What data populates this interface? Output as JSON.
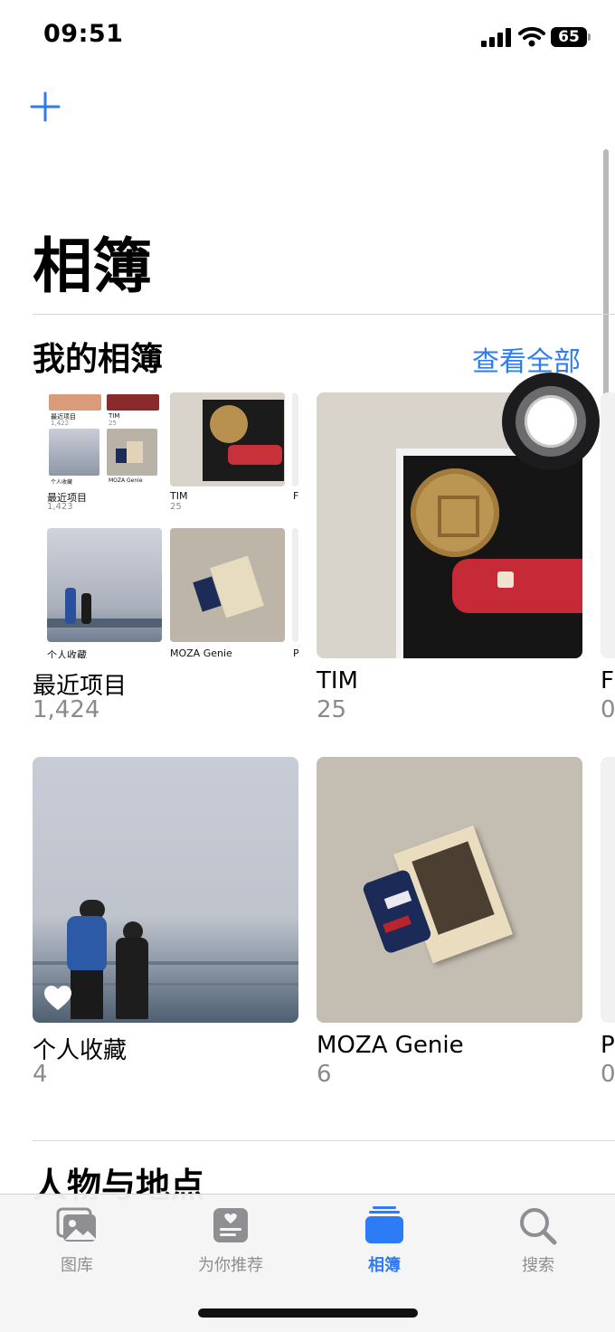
{
  "status_bar": {
    "time": "09:51",
    "battery": "65"
  },
  "header": {
    "title": "相簿"
  },
  "my_albums": {
    "title": "我的相簿",
    "see_all": "查看全部",
    "albums": [
      {
        "name": "最近项目",
        "count": "1,424"
      },
      {
        "name": "TIM",
        "count": "25"
      },
      {
        "name": "F",
        "count": "0"
      },
      {
        "name": "个人收藏",
        "count": "4"
      },
      {
        "name": "MOZA Genie",
        "count": "6"
      },
      {
        "name": "P",
        "count": "0"
      }
    ],
    "mini_grid": {
      "items": [
        {
          "name": "最近项目",
          "count": "1,423"
        },
        {
          "name": "TIM",
          "count": "25"
        },
        {
          "name": "F",
          "count": ""
        },
        {
          "name": "个人收藏",
          "count": ""
        },
        {
          "name": "MOZA Genie",
          "count": ""
        },
        {
          "name": "P",
          "count": ""
        }
      ],
      "tiny_rows": [
        {
          "name": "最近项目",
          "count": "1,422"
        },
        {
          "name": "TIM",
          "count": "25"
        },
        {
          "name": "个人收藏",
          "count": ""
        },
        {
          "name": "MOZA Genie",
          "count": ""
        }
      ]
    }
  },
  "people_places": {
    "title": "人物与地点"
  },
  "tab_bar": {
    "tabs": [
      {
        "label": "图库",
        "icon": "photo-library-icon",
        "active": false
      },
      {
        "label": "为你推荐",
        "icon": "for-you-icon",
        "active": false
      },
      {
        "label": "相簿",
        "icon": "albums-icon",
        "active": true
      },
      {
        "label": "搜索",
        "icon": "search-icon",
        "active": false
      }
    ]
  },
  "colors": {
    "accent": "#2e7bf6",
    "secondary_text": "#8a8a8e"
  }
}
